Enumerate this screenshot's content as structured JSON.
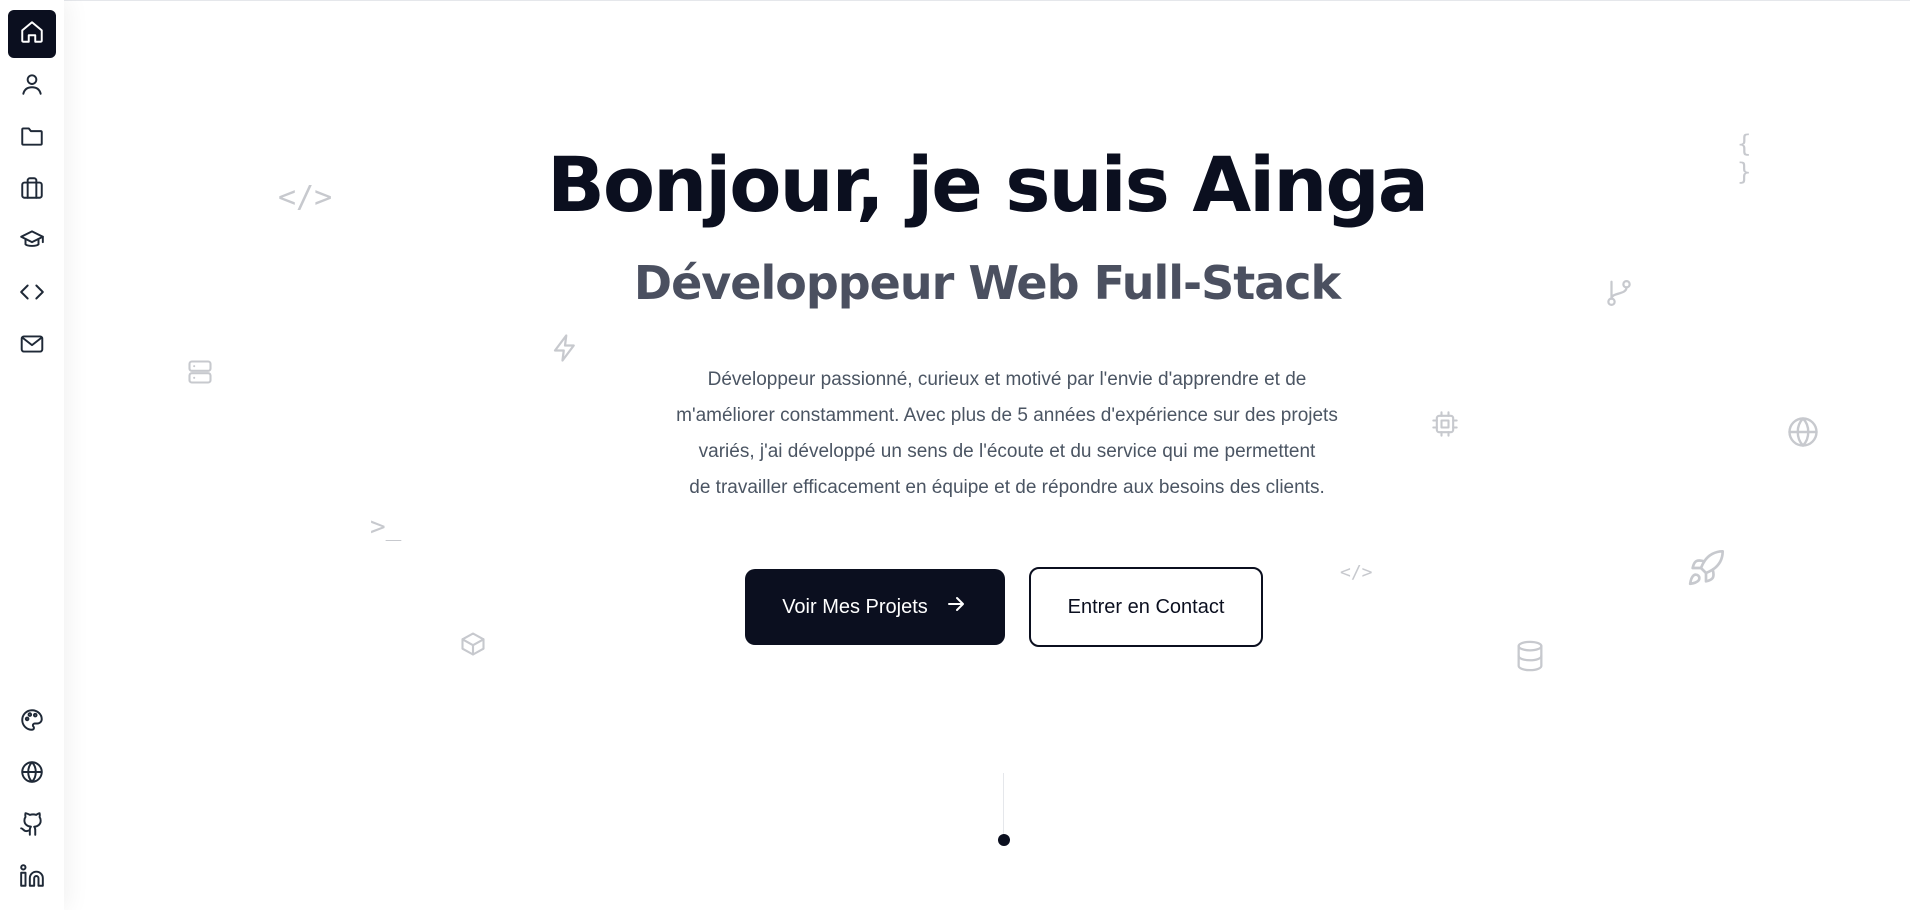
{
  "sidebar": {
    "top_items": [
      {
        "icon": "home-icon",
        "active": true
      },
      {
        "icon": "user-icon"
      },
      {
        "icon": "folder-icon"
      },
      {
        "icon": "briefcase-icon"
      },
      {
        "icon": "graduation-cap-icon"
      },
      {
        "icon": "code-icon"
      },
      {
        "icon": "mail-icon"
      }
    ],
    "bottom_items": [
      {
        "icon": "palette-icon"
      },
      {
        "icon": "globe-icon"
      },
      {
        "icon": "github-icon"
      },
      {
        "icon": "linkedin-icon"
      }
    ]
  },
  "hero": {
    "title": "Bonjour, je suis Ainga",
    "subtitle": "Développeur Web Full-Stack",
    "description_lines": [
      "Développeur passionné, curieux et motivé par l'envie d'apprendre et de",
      "m'améliorer constamment. Avec plus de 5 années d'expérience sur des projets",
      "variés, j'ai développé un sens de l'écoute et du service qui me permettent",
      "de travailler efficacement en équipe et de répondre aux besoins des clients."
    ],
    "primary_button": "Voir Mes Projets",
    "secondary_button": "Entrer en Contact"
  },
  "decorations": {
    "code_tag": "</>",
    "code_tag_small": "</>",
    "braces": "{ }",
    "terminal": ">_"
  },
  "colors": {
    "primary": "#0b0f1f",
    "subtitle": "#4b5060",
    "body_text": "#4b5563",
    "decoration": "#c7c9ce"
  }
}
